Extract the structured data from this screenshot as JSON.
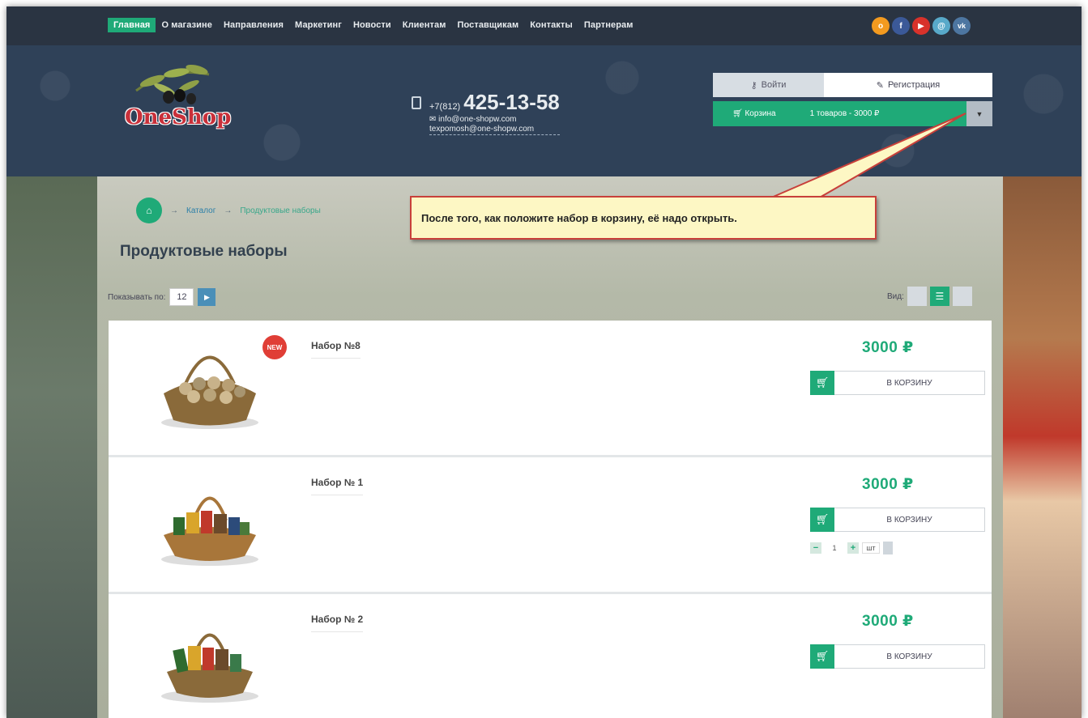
{
  "nav": {
    "items": [
      "Главная",
      "О магазине",
      "Направления",
      "Маркетинг",
      "Новости",
      "Клиентам",
      "Поставщикам",
      "Контакты",
      "Партнерам"
    ],
    "active_index": 0,
    "social": [
      {
        "icon": "odnoklassniki-icon",
        "color": "#f39a1f",
        "glyph": "o"
      },
      {
        "icon": "facebook-icon",
        "color": "#3b5998",
        "glyph": "f"
      },
      {
        "icon": "youtube-icon",
        "color": "#d8322b",
        "glyph": "▶"
      },
      {
        "icon": "mail-icon",
        "color": "#58a9c9",
        "glyph": "@"
      },
      {
        "icon": "vk-icon",
        "color": "#4d76a1",
        "glyph": "vk"
      }
    ]
  },
  "header": {
    "logo_text": "OneShop",
    "phone_code": "+7(812)",
    "phone": "425-13-58",
    "email": "info@one-shopw.com",
    "email2": "texpomosh@one-shopw.com",
    "login_label": "Войти",
    "register_label": "Регистрация",
    "cart_label": "Корзина",
    "cart_summary": "1 товаров - 3000 ₽"
  },
  "breadcrumb": {
    "items": [
      "Каталог",
      "Продуктовые наборы"
    ]
  },
  "page": {
    "title": "Продуктовые наборы",
    "show_by_label": "Показывать по:",
    "show_by_value": "12",
    "view_label": "Вид:"
  },
  "products": [
    {
      "name": "Набор №8",
      "price": "3000 ₽",
      "buy_label": "В КОРЗИНУ",
      "badge": "NEW"
    },
    {
      "name": "Набор № 1",
      "price": "3000 ₽",
      "buy_label": "В КОРЗИНУ",
      "qty": "1",
      "unit": "шт"
    },
    {
      "name": "Набор № 2",
      "price": "3000 ₽",
      "buy_label": "В КОРЗИНУ"
    }
  ],
  "callout": {
    "text": "После того, как положите набор в корзину, её надо открыть."
  },
  "colors": {
    "accent": "#1faa78",
    "nav_bg": "#2a3442",
    "header_bg": "#2f4158",
    "callout_border": "#c8403a",
    "callout_bg": "#fdf7c4"
  }
}
